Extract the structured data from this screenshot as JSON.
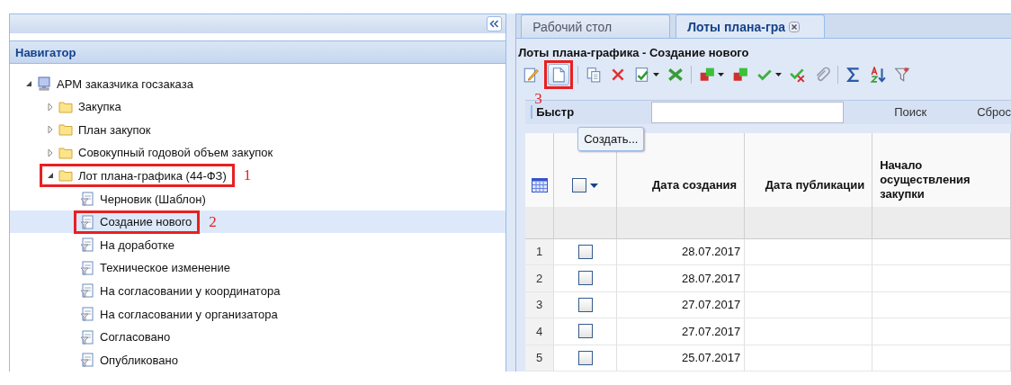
{
  "navigator": {
    "title": "Навигатор",
    "tree": [
      {
        "label": "АРМ заказчика госзаказа",
        "kind": "workstation",
        "expanded": true,
        "selected": false,
        "children": [
          {
            "label": "Закупка",
            "kind": "folder",
            "expanded": false,
            "selected": false
          },
          {
            "label": "План закупок",
            "kind": "folder",
            "expanded": false,
            "selected": false
          },
          {
            "label": "Совокупный годовой объем закупок",
            "kind": "folder",
            "expanded": false,
            "selected": false
          },
          {
            "label": "Лот плана-графика (44-ФЗ)",
            "kind": "folder",
            "expanded": true,
            "selected": false,
            "annotation": "1",
            "children": [
              {
                "label": "Черновик (Шаблон)",
                "kind": "filter",
                "selected": false
              },
              {
                "label": "Создание нового",
                "kind": "filter",
                "selected": true,
                "annotation": "2"
              },
              {
                "label": "На доработке",
                "kind": "filter",
                "selected": false
              },
              {
                "label": "Техническое изменение",
                "kind": "filter",
                "selected": false
              },
              {
                "label": "На согласовании у координатора",
                "kind": "filter",
                "selected": false
              },
              {
                "label": "На согласовании у организатора",
                "kind": "filter",
                "selected": false
              },
              {
                "label": "Согласовано",
                "kind": "filter",
                "selected": false
              },
              {
                "label": "Опубликовано",
                "kind": "filter",
                "selected": false
              }
            ]
          }
        ]
      }
    ]
  },
  "tabs": [
    {
      "label": "Рабочий стол",
      "selected": false,
      "closable": false
    },
    {
      "label": "Лоты плана-гра",
      "selected": true,
      "closable": true
    }
  ],
  "panel_title": "Лоты плана-графика - Создание нового",
  "toolbar": {
    "groups": [
      [
        {
          "pressed": false,
          "menu": false
        },
        {
          "pressed": true,
          "menu": false,
          "annotation": "3"
        }
      ],
      [
        {
          "pressed": false,
          "menu": false
        },
        {
          "pressed": false,
          "menu": false
        },
        {
          "pressed": false,
          "menu": true
        },
        {
          "pressed": false,
          "menu": false
        }
      ],
      [
        {
          "pressed": false,
          "menu": true
        },
        {
          "pressed": false,
          "menu": false
        },
        {
          "pressed": false,
          "menu": true
        },
        {
          "pressed": false,
          "menu": false
        },
        {
          "pressed": false,
          "menu": false
        }
      ],
      [
        {
          "pressed": false,
          "menu": false
        },
        {
          "pressed": false,
          "menu": false
        },
        {
          "pressed": false,
          "menu": false
        }
      ]
    ]
  },
  "tooltip": "Создать...",
  "quick_search": {
    "label": "Быстр",
    "search_button": "Поиск",
    "reset_button": "Сброс"
  },
  "grid": {
    "columns": [
      "Дата создания",
      "Дата публикации",
      "Начало осуществления закупки"
    ],
    "select_all_checked": false,
    "rows": [
      {
        "number": "1",
        "checked": false,
        "created": "28.07.2017"
      },
      {
        "number": "2",
        "checked": false,
        "created": "28.07.2017"
      },
      {
        "number": "3",
        "checked": false,
        "created": "27.07.2017"
      },
      {
        "number": "4",
        "checked": false,
        "created": "27.07.2017"
      },
      {
        "number": "5",
        "checked": false,
        "created": "25.07.2017"
      }
    ]
  }
}
